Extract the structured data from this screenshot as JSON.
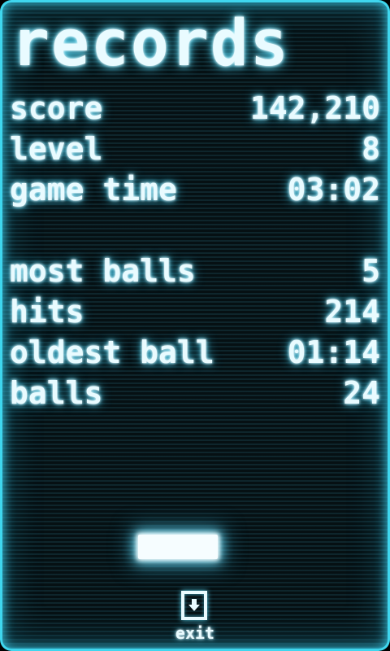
{
  "title": "records",
  "stats": [
    {
      "label": "score",
      "value": "142,210"
    },
    {
      "label": "level",
      "value": "8"
    },
    {
      "label": "game time",
      "value": "03:02"
    },
    {
      "label": "most balls",
      "value": "5"
    },
    {
      "label": "hits",
      "value": "214"
    },
    {
      "label": "oldest ball",
      "value": "01:14"
    },
    {
      "label": "balls",
      "value": "24"
    }
  ],
  "exit": {
    "label": "exit",
    "icon": "down-arrow-icon"
  },
  "colors": {
    "glow": "#3fd6ee",
    "text": "#e9fbff",
    "background": "#061013"
  }
}
